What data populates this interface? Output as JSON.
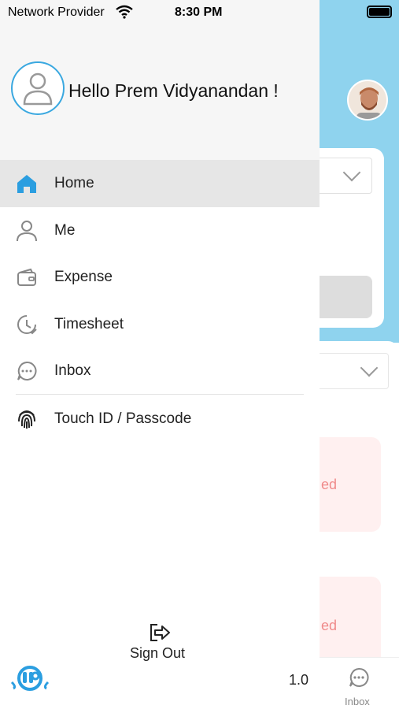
{
  "status_bar": {
    "carrier": "Network Provider",
    "time": "8:30 PM"
  },
  "drawer": {
    "greeting": "Hello Prem Vidyanandan !",
    "menu": [
      {
        "label": "Home",
        "icon": "home-icon",
        "active": true
      },
      {
        "label": "Me",
        "icon": "person-icon",
        "active": false
      },
      {
        "label": "Expense",
        "icon": "wallet-icon",
        "active": false
      },
      {
        "label": "Timesheet",
        "icon": "clock-icon",
        "active": false
      },
      {
        "label": "Inbox",
        "icon": "chat-icon",
        "active": false
      }
    ],
    "touch_id": {
      "label": "Touch ID / Passcode",
      "icon": "fingerprint-icon"
    },
    "sign_out_label": "Sign Out",
    "version": "1.0",
    "accent_color": "#3aa8e0"
  },
  "background": {
    "pink_card_1_text": "ed",
    "pink_card_2_text": "ed",
    "tab_inbox_label": "Inbox",
    "header_color": "#8fd3ee"
  }
}
